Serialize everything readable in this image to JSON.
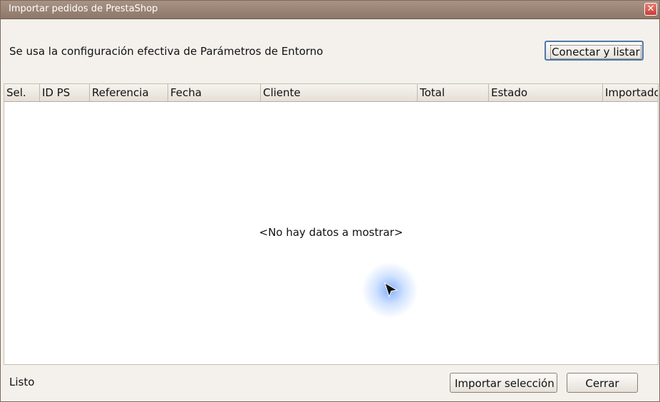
{
  "window": {
    "title": "Importar pedidos de PrestaShop",
    "close_glyph": "✕"
  },
  "info": {
    "text": "Se usa la configuración efectiva de Parámetros de Entorno"
  },
  "toolbar": {
    "connect_label": "Conectar y listar"
  },
  "table": {
    "columns": [
      "Sel.",
      "ID PS",
      "Referencia",
      "Fecha",
      "Cliente",
      "Total",
      "Estado",
      "Importado"
    ],
    "rows": [],
    "empty_message": "<No hay datos a mostrar>"
  },
  "status": {
    "text": "Listo"
  },
  "footer": {
    "import_label": "Importar selección",
    "close_label": "Cerrar"
  },
  "colors": {
    "titlebar": "#9a8576",
    "window_bg": "#f4f1ec",
    "close_button": "#d9534a",
    "focus_border": "#4f77a8"
  }
}
